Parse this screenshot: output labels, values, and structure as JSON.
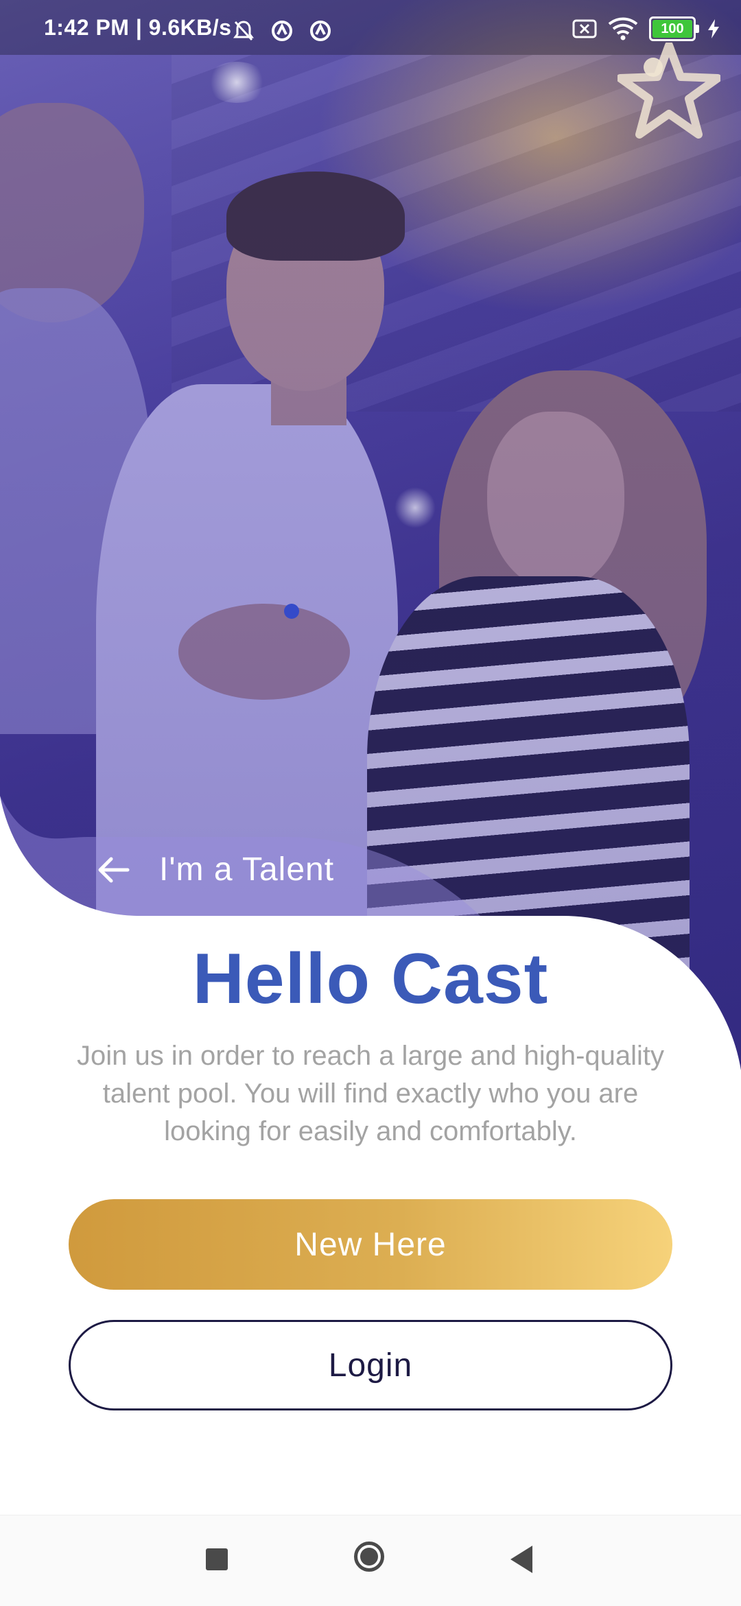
{
  "status_bar": {
    "time_and_speed": "1:42 PM | 9.6KB/s",
    "battery_level": "100",
    "icons": [
      "bell-off-icon",
      "app-notification-icon",
      "app-notification-icon",
      "sim-x-icon",
      "wifi-icon",
      "battery-icon",
      "charging-icon"
    ]
  },
  "header": {
    "logo": "star-person-logo"
  },
  "tab": {
    "label": "I'm a Talent",
    "icon": "arrow-left-icon"
  },
  "main": {
    "title": "Hello Cast",
    "description": "Join us in order to reach a large and high-quality talent pool. You will find exactly who you are looking for easily and comfortably."
  },
  "buttons": {
    "new_here": "New Here",
    "login": "Login"
  },
  "colors": {
    "title": "#3b5ab8",
    "primary_gold": "#dcae52",
    "login_border": "#1d1a44",
    "body_text": "#a3a3a3"
  },
  "navigation_bar": {
    "icons": [
      "recents-square-icon",
      "home-circle-icon",
      "back-triangle-icon"
    ]
  }
}
